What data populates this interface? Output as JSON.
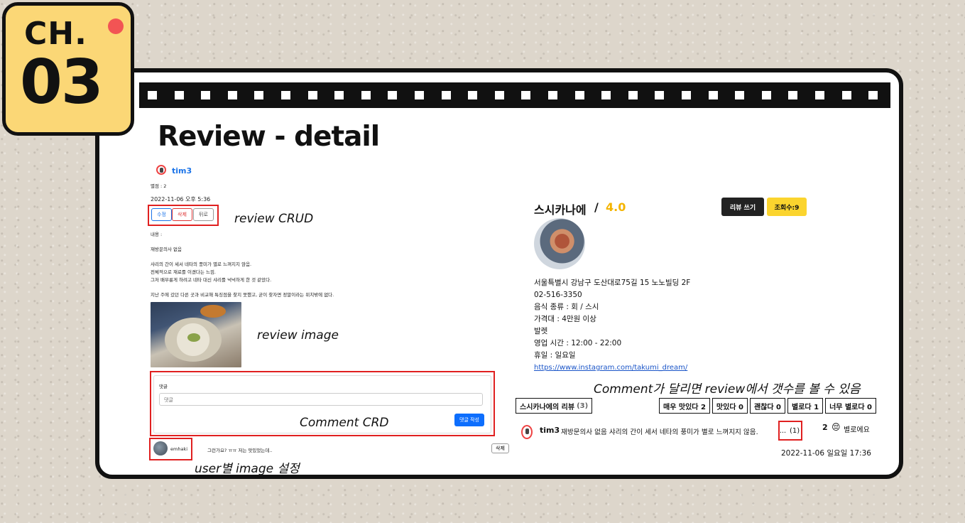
{
  "chapter": {
    "prefix": "CH.",
    "number": "03"
  },
  "slide_title": "Review - detail",
  "review": {
    "author": "tim3",
    "rating_label": "별점 : 2",
    "timestamp": "2022-11-06 오후 5:36",
    "buttons": {
      "edit": "수정",
      "delete": "삭제",
      "back": "뒤로"
    },
    "content_label": "내용 :",
    "paragraphs": [
      "재방문의사 없음",
      "샤리의 간이 세서 네타의 풍미가 별로 느껴지지 않음.",
      "전체적으로 재료를 이겼다는 느낌.",
      "그저 배부룽게 하려고 네타 대신 샤리를 넉넉하게 한 것 같았다.",
      "지난 주에 갔던 다른 곳과 비교해 특징점을 찾지 못했고, 굳이 찾자면 정말이라는 위치밖에 없다."
    ]
  },
  "comment_form": {
    "label": "댓글",
    "placeholder": "댓글",
    "submit": "댓글 작성"
  },
  "comments": [
    {
      "user": "emhaki",
      "text": "그런가요? ㅠㅠ 저는 맛있었는데..",
      "delete": "삭제"
    }
  ],
  "annotations": {
    "crud": "review CRUD",
    "image": "review image",
    "comment": "Comment CRD",
    "user_image": "user별 image 설정",
    "comment_count": "Comment가 달리면 review에서 갯수를 볼 수 있음"
  },
  "restaurant": {
    "name": "스시카나에",
    "separator": "/",
    "score": "4.0",
    "write_button": "리뷰 쓰기",
    "views": "조회수:9",
    "address": "서울특별시 강남구 도산대로75길 15 노노빌딩 2F",
    "phone": "02-516-3350",
    "food_type": "음식 종류 : 회 / 스시",
    "price": "가격대 : 4만원 이상",
    "parking": "발렛",
    "hours": "영업 시간 : 12:00 - 22:00",
    "holiday": "휴일 : 일요일",
    "link": "https://www.instagram.com/takumi_dream/"
  },
  "review_list": {
    "title": "스시카나에의 리뷰",
    "count": "(3)",
    "filters": [
      "매우 맛있다 2",
      "맛있다 0",
      "괜찮다 0",
      "별로다 1",
      "너무 별로다 0"
    ],
    "item": {
      "author": "tim3",
      "text": "재방문의사 없음 샤리의 간이 세서 네타의 풍미가 별로 느껴지지 않음.",
      "ellipsis": "...",
      "comment_count": "(1)",
      "rating": "2",
      "rating_emoji": "😔",
      "rating_text": "별로에요",
      "date": "2022-11-06 일요일 17:36"
    }
  },
  "colors": {
    "badge": "#fbd776",
    "accent_red": "#e02020",
    "score": "#f4b400",
    "primary": "#0d6efd"
  }
}
